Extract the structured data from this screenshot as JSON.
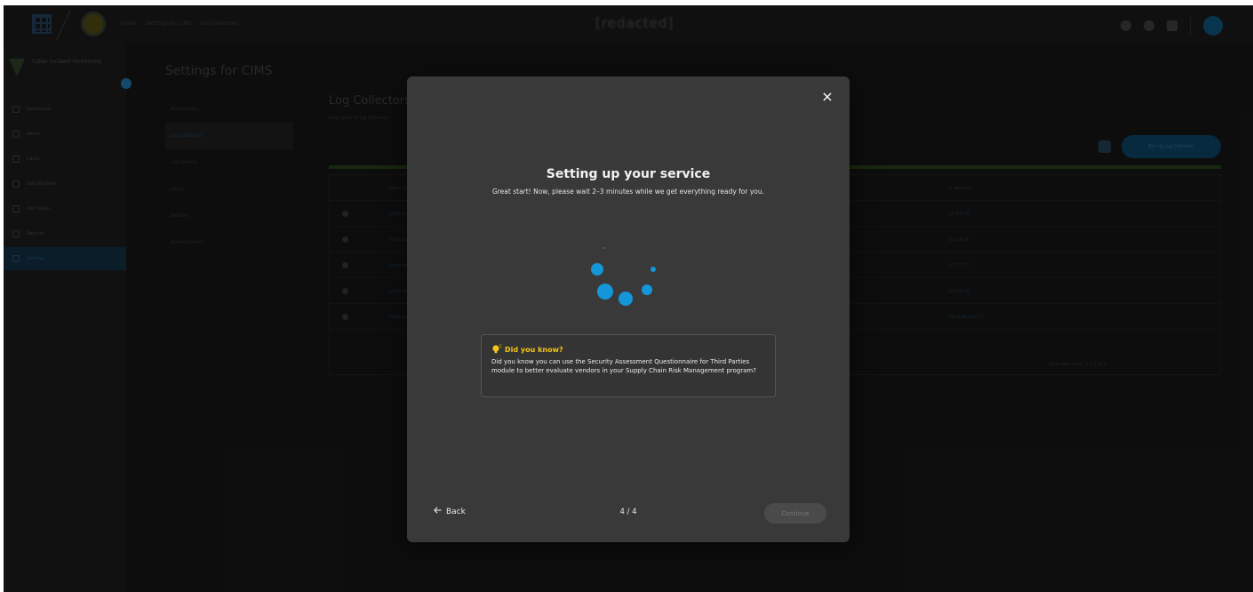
{
  "app": {
    "breadcrumbs": [
      "Home",
      "Settings for CIMS",
      "Log Collectors"
    ],
    "window_title": "[redacted]"
  },
  "sidebar": {
    "brand": "Cyber Incident Monitoring",
    "items": [
      {
        "label": "Dashboard",
        "icon": "grid-icon"
      },
      {
        "label": "Alerts",
        "icon": "bell-icon"
      },
      {
        "label": "Cases",
        "icon": "folder-icon"
      },
      {
        "label": "Data Explorer",
        "icon": "search-icon"
      },
      {
        "label": "Alert Rules",
        "icon": "rule-icon"
      },
      {
        "label": "Reports",
        "icon": "report-icon"
      },
      {
        "label": "Settings",
        "icon": "gear-icon",
        "active": true
      }
    ]
  },
  "settings": {
    "title": "Settings for CIMS",
    "nav": [
      "Notifications",
      "Log Collectors",
      "Log Sources",
      "Users",
      "Network",
      "Access Control"
    ],
    "active": "Log Collectors"
  },
  "content": {
    "title": "Log Collectors",
    "subtitle": "Keep track of log collectors",
    "add_button": "Set Up Log Collector",
    "columns": [
      "Agent Name",
      "IP Address"
    ],
    "rows": [
      {
        "name": "collector-01",
        "ip": "10.0.0.15"
      },
      {
        "name": "collector-02",
        "ip": "10.0.0.16"
      },
      {
        "name": "collector-03",
        "ip": "10.0.0.17"
      },
      {
        "name": "collector-04",
        "ip": "10.0.0.18"
      },
      {
        "name": "collector-05",
        "ip": "192.168.100.25"
      }
    ],
    "footer": "Rows per page: 5   1-5 of 5"
  },
  "modal": {
    "title": "Setting up your service",
    "subtitle": "Great start! Now, please wait 2–3 minutes while we get everything ready for you.",
    "close_label": "×",
    "tip": {
      "heading": "Did you know?",
      "icon": "lightbulb-icon",
      "body": "Did you know you can use the Security Assessment Questionnaire for Third Parties module to better evaluate vendors in your Supply Chain Risk Management program?"
    },
    "back_label": "Back",
    "step": "4 / 4",
    "continue_label": "Continue",
    "continue_disabled": true
  },
  "colors": {
    "accent": "#1596d8",
    "tip_heading": "#f5c518",
    "modal_bg": "#393939",
    "page_bg": "#141414"
  }
}
